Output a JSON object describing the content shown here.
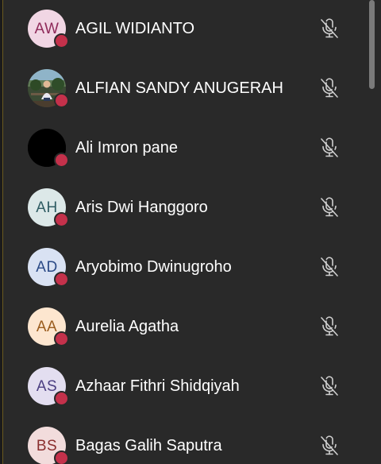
{
  "participants": [
    {
      "name": "AGIL WIDIANTO",
      "initials": "AW",
      "avatar_bg": "#f1d6e4",
      "avatar_fg": "#8f2a5a",
      "avatar_type": "initials",
      "status": "busy",
      "mic": "muted-mic-icon"
    },
    {
      "name": "ALFIAN SANDY ANUGERAH",
      "initials": "",
      "avatar_bg": "#2d3b2c",
      "avatar_fg": "#ffffff",
      "avatar_type": "photo",
      "status": "busy",
      "mic": "muted-mic-icon"
    },
    {
      "name": "Ali Imron pane",
      "initials": "",
      "avatar_bg": "#000000",
      "avatar_fg": "#ffffff",
      "avatar_type": "photo-black",
      "status": "busy",
      "mic": "muted-mic-icon"
    },
    {
      "name": "Aris Dwi Hanggoro",
      "initials": "AH",
      "avatar_bg": "#dce8e8",
      "avatar_fg": "#2f5c63",
      "avatar_type": "initials",
      "status": "busy",
      "mic": "muted-mic-icon"
    },
    {
      "name": "Aryobimo Dwinugroho",
      "initials": "AD",
      "avatar_bg": "#d9e2f3",
      "avatar_fg": "#2b4a86",
      "avatar_type": "initials",
      "status": "busy",
      "mic": "muted-mic-icon"
    },
    {
      "name": "Aurelia Agatha",
      "initials": "AA",
      "avatar_bg": "#fde6cf",
      "avatar_fg": "#9a5c1e",
      "avatar_type": "initials",
      "status": "busy",
      "mic": "muted-mic-icon"
    },
    {
      "name": "Azhaar Fithri Shidqiyah",
      "initials": "AS",
      "avatar_bg": "#e3def0",
      "avatar_fg": "#4c3f82",
      "avatar_type": "initials",
      "status": "busy",
      "mic": "muted-mic-icon"
    },
    {
      "name": "Bagas Galih Saputra",
      "initials": "BS",
      "avatar_bg": "#f2dcdc",
      "avatar_fg": "#8a2e2e",
      "avatar_type": "initials",
      "status": "busy",
      "mic": "muted-mic-icon"
    }
  ],
  "colors": {
    "panel_bg": "#292929",
    "status_busy": "#c4314b",
    "text": "#ffffff",
    "icon": "#d0d0d0"
  }
}
